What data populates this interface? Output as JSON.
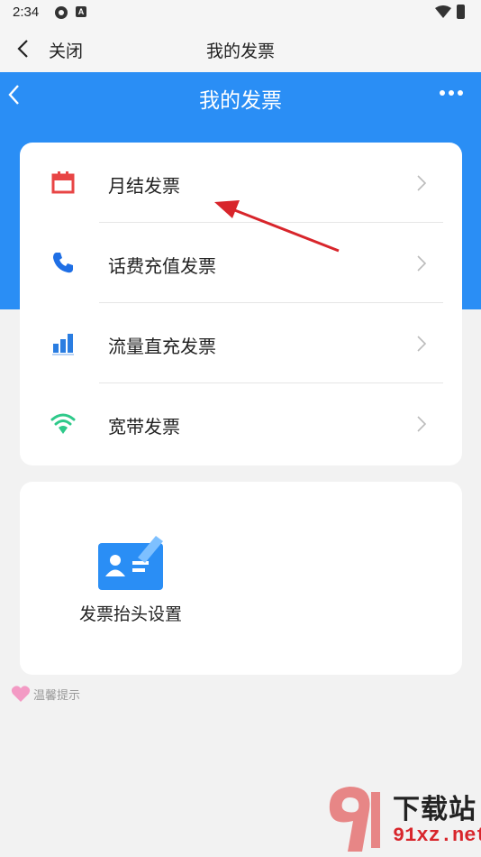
{
  "status_bar": {
    "time": "2:34"
  },
  "webview": {
    "close_label": "关闭",
    "title": "我的发票"
  },
  "header": {
    "title": "我的发票"
  },
  "menu": [
    {
      "label": "月结发票",
      "icon": "calendar-icon",
      "color": "#e84545"
    },
    {
      "label": "话费充值发票",
      "icon": "phone-icon",
      "color": "#1f6fe5"
    },
    {
      "label": "流量直充发票",
      "icon": "bar-chart-icon",
      "color": "#2a7de1"
    },
    {
      "label": "宽带发票",
      "icon": "wifi-icon",
      "color": "#2ec98a"
    }
  ],
  "settings": {
    "label": "发票抬头设置",
    "icon": "id-card-edit-icon"
  },
  "tip": {
    "label": "温馨提示"
  },
  "watermark": {
    "text": "下载站",
    "domain": "91xz.net"
  },
  "colors": {
    "header_blue": "#2a8ef5",
    "arrow_red": "#d8252b"
  }
}
